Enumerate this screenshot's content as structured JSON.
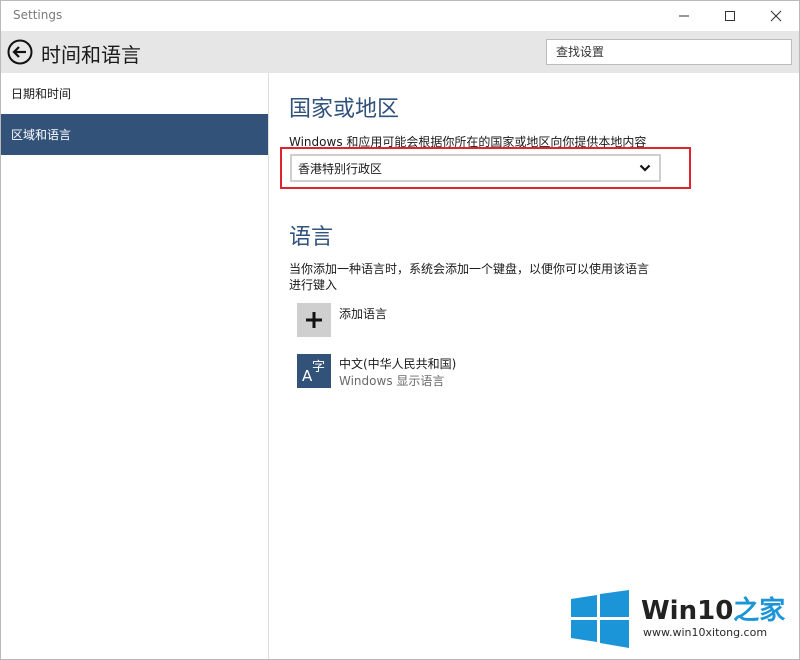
{
  "window": {
    "title": "Settings"
  },
  "header": {
    "title": "时间和语言",
    "search_placeholder": "查找设置"
  },
  "sidebar": {
    "items": [
      {
        "label": "日期和时间",
        "active": false
      },
      {
        "label": "区域和语言",
        "active": true
      }
    ]
  },
  "main": {
    "region": {
      "title": "国家或地区",
      "description": "Windows 和应用可能会根据你所在的国家或地区向你提供本地内容",
      "selected": "香港特别行政区"
    },
    "language": {
      "title": "语言",
      "description_line1": "当你添加一种语言时，系统会添加一个键盘，以便你可以使用该语言",
      "description_line2": "进行键入",
      "add_label": "添加语言",
      "items": [
        {
          "name": "中文(中华人民共和国)",
          "subtitle": "Windows 显示语言",
          "tile_text_a": "A",
          "tile_text_b": "字"
        }
      ]
    }
  },
  "watermark": {
    "brand_main": "Win10",
    "brand_accent": "之家",
    "url": "www.win10xitong.com"
  },
  "colors": {
    "accent": "#33527a",
    "highlight": "#e0242b",
    "brand_blue": "#1c95d8"
  },
  "icons": {
    "back": "back-arrow-icon",
    "add": "plus-icon",
    "chevron": "chevron-down-icon",
    "logo": "windows-logo-icon"
  }
}
